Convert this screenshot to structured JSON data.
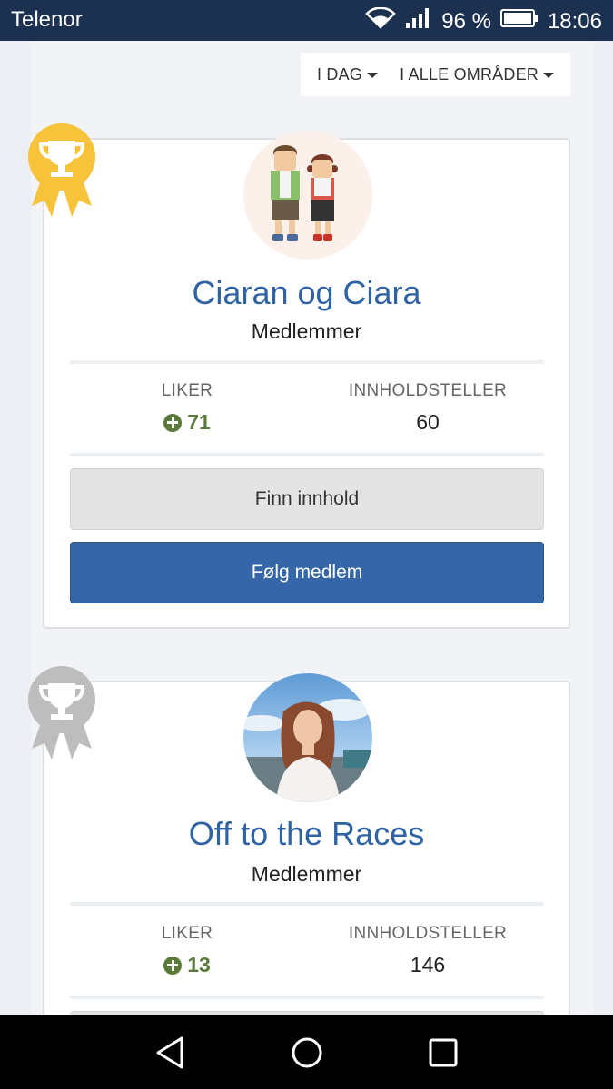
{
  "status_bar": {
    "carrier": "Telenor",
    "battery": "96 %",
    "time": "18:06",
    "icons": [
      "wifi-icon",
      "signal-icon",
      "battery-icon"
    ]
  },
  "filters": {
    "period": "I DAG",
    "area": "I ALLE OMRÅDER"
  },
  "members": [
    {
      "rank": "gold-trophy-badge",
      "name": "Ciaran og Ciara",
      "role": "Medlemmer",
      "likes_label": "LIKER",
      "likes_value": "71",
      "content_label": "INNHOLDSTELLER",
      "content_value": "60",
      "find_content": "Finn innhold",
      "follow": "Følg medlem"
    },
    {
      "rank": "silver-trophy-badge",
      "name": "Off to the Races",
      "role": "Medlemmer",
      "likes_label": "LIKER",
      "likes_value": "13",
      "content_label": "INNHOLDSTELLER",
      "content_value": "146"
    }
  ],
  "colors": {
    "status_bar": "#1c3050",
    "link_blue": "#2f63a3",
    "follow_button": "#3466a8",
    "likes_green": "#5a7a3a",
    "gold": "#f6c33b",
    "silver": "#bdbdbd"
  },
  "nav_bar": {
    "icons": [
      "back-icon",
      "home-icon",
      "recents-icon"
    ]
  }
}
